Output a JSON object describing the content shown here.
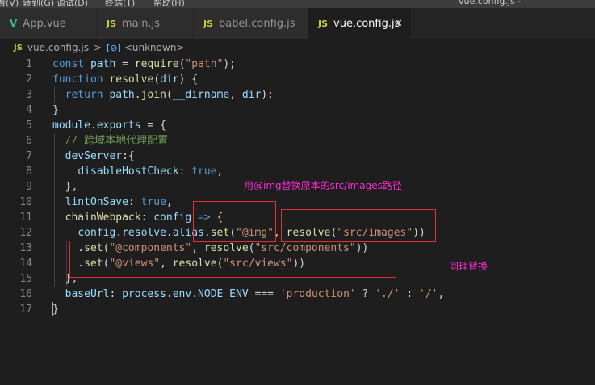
{
  "menu": [
    "看(V)",
    "转到(G)",
    "调试(D)",
    "终端(T)",
    "帮助(H)"
  ],
  "window_title": "vue.config.js - kuanjie_calculator",
  "tabs": [
    {
      "icon": "V",
      "label": "App.vue",
      "active": false
    },
    {
      "icon": "JS",
      "label": "main.js",
      "active": false
    },
    {
      "icon": "JS",
      "label": "babel.config.js",
      "active": false
    },
    {
      "icon": "JS",
      "label": "vue.config.js",
      "active": true
    }
  ],
  "breadcrumb": {
    "file": "vue.config.js",
    "separator": ">",
    "symbol": "<unknown>"
  },
  "lines": [
    {
      "n": "1",
      "tokens": [
        [
          "k",
          "const "
        ],
        [
          "v",
          "path"
        ],
        [
          "t",
          " = "
        ],
        [
          "f",
          "require"
        ],
        [
          "t",
          "("
        ],
        [
          "s",
          "\"path\""
        ],
        [
          "t",
          ");"
        ]
      ]
    },
    {
      "n": "2",
      "tokens": [
        [
          "k",
          "function "
        ],
        [
          "f",
          "resolve"
        ],
        [
          "t",
          "("
        ],
        [
          "v",
          "dir"
        ],
        [
          "t",
          ") {"
        ]
      ]
    },
    {
      "n": "3",
      "tokens": [
        [
          "t",
          "  "
        ],
        [
          "k",
          "return "
        ],
        [
          "v",
          "path"
        ],
        [
          "t",
          "."
        ],
        [
          "f",
          "join"
        ],
        [
          "t",
          "("
        ],
        [
          "v",
          "__dirname"
        ],
        [
          "t",
          ", "
        ],
        [
          "v",
          "dir"
        ],
        [
          "t",
          ");"
        ]
      ]
    },
    {
      "n": "4",
      "tokens": [
        [
          "t",
          "}"
        ]
      ]
    },
    {
      "n": "5",
      "tokens": [
        [
          "v",
          "module"
        ],
        [
          "t",
          "."
        ],
        [
          "v",
          "exports"
        ],
        [
          "t",
          " = {"
        ]
      ]
    },
    {
      "n": "6",
      "tokens": [
        [
          "t",
          "  "
        ],
        [
          "c",
          "// 跨域本地代理配置"
        ]
      ]
    },
    {
      "n": "7",
      "tokens": [
        [
          "t",
          "  "
        ],
        [
          "v",
          "devServer"
        ],
        [
          "t",
          ":{"
        ]
      ]
    },
    {
      "n": "8",
      "tokens": [
        [
          "t",
          "    "
        ],
        [
          "v",
          "disableHostCheck"
        ],
        [
          "t",
          ": "
        ],
        [
          "k",
          "true"
        ],
        [
          "t",
          ","
        ]
      ]
    },
    {
      "n": "9",
      "tokens": [
        [
          "t",
          "  },"
        ]
      ]
    },
    {
      "n": "10",
      "tokens": [
        [
          "t",
          "  "
        ],
        [
          "v",
          "lintOnSave"
        ],
        [
          "t",
          ": "
        ],
        [
          "k",
          "true"
        ],
        [
          "t",
          ","
        ]
      ]
    },
    {
      "n": "11",
      "tokens": [
        [
          "t",
          "  "
        ],
        [
          "f",
          "chainWebpack"
        ],
        [
          "t",
          ": "
        ],
        [
          "v",
          "config"
        ],
        [
          "t",
          " "
        ],
        [
          "k",
          "=>"
        ],
        [
          "t",
          " {"
        ]
      ]
    },
    {
      "n": "12",
      "tokens": [
        [
          "t",
          "    "
        ],
        [
          "v",
          "config"
        ],
        [
          "t",
          "."
        ],
        [
          "v",
          "resolve"
        ],
        [
          "t",
          "."
        ],
        [
          "v",
          "alias"
        ],
        [
          "t",
          "."
        ],
        [
          "f",
          "set"
        ],
        [
          "t",
          "("
        ],
        [
          "s",
          "\"@img\""
        ],
        [
          "t",
          ", "
        ],
        [
          "f",
          "resolve"
        ],
        [
          "t",
          "("
        ],
        [
          "s",
          "\"src/images\""
        ],
        [
          "t",
          "))"
        ]
      ]
    },
    {
      "n": "13",
      "tokens": [
        [
          "t",
          "    ."
        ],
        [
          "f",
          "set"
        ],
        [
          "t",
          "("
        ],
        [
          "s",
          "\"@components\""
        ],
        [
          "t",
          ", "
        ],
        [
          "f",
          "resolve"
        ],
        [
          "t",
          "("
        ],
        [
          "s",
          "\"src/components\""
        ],
        [
          "t",
          "))"
        ]
      ]
    },
    {
      "n": "14",
      "tokens": [
        [
          "t",
          "    ."
        ],
        [
          "f",
          "set"
        ],
        [
          "t",
          "("
        ],
        [
          "s",
          "\"@views\""
        ],
        [
          "t",
          ", "
        ],
        [
          "f",
          "resolve"
        ],
        [
          "t",
          "("
        ],
        [
          "s",
          "\"src/views\""
        ],
        [
          "t",
          "))"
        ]
      ]
    },
    {
      "n": "15",
      "tokens": [
        [
          "t",
          "  },"
        ]
      ]
    },
    {
      "n": "16",
      "tokens": [
        [
          "t",
          "  "
        ],
        [
          "v",
          "baseUrl"
        ],
        [
          "t",
          ": "
        ],
        [
          "v",
          "process"
        ],
        [
          "t",
          "."
        ],
        [
          "v",
          "env"
        ],
        [
          "t",
          "."
        ],
        [
          "v",
          "NODE_ENV"
        ],
        [
          "t",
          " === "
        ],
        [
          "s",
          "'production'"
        ],
        [
          "t",
          " ? "
        ],
        [
          "s",
          "'./'"
        ],
        [
          "t",
          " : "
        ],
        [
          "s",
          "'/'"
        ],
        [
          "t",
          ","
        ]
      ]
    },
    {
      "n": "17",
      "tokens": [
        [
          "t",
          "}"
        ]
      ]
    }
  ],
  "annotations": {
    "note1": "用@img替换原本的src/images路径",
    "note2": "同理替换"
  },
  "colors": {
    "annotation_box": "#e03030",
    "annotation_text": "#ff2ad4",
    "keyword": "#569cd6",
    "string": "#ce9178",
    "function": "#dcdcaa",
    "variable": "#9cdcfe",
    "comment": "#6a9955"
  }
}
